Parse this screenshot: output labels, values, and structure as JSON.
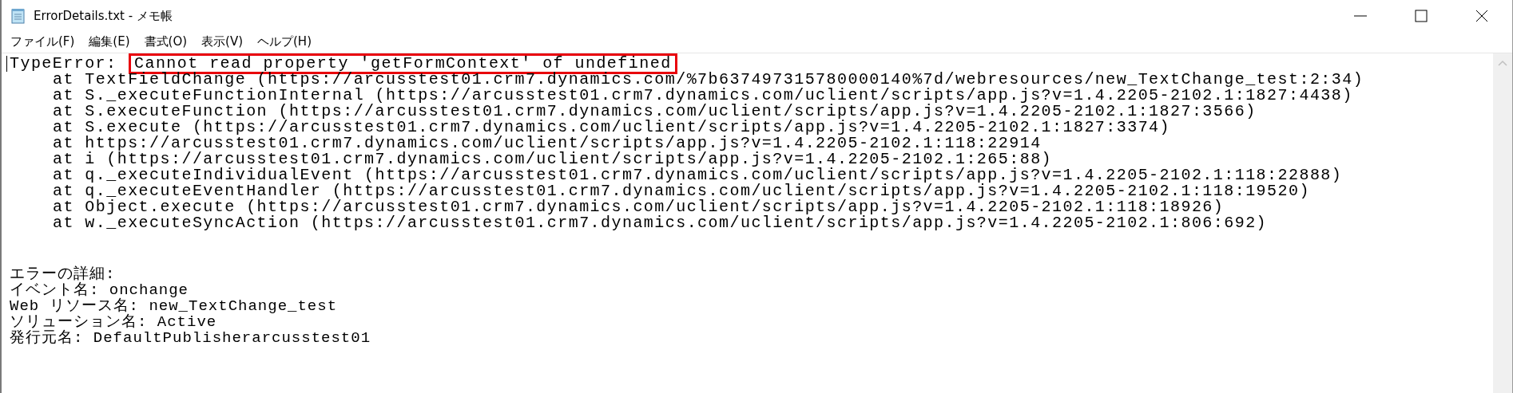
{
  "window": {
    "title": "ErrorDetails.txt - メモ帳"
  },
  "menu": [
    {
      "label": "ファイル(F)"
    },
    {
      "label": "編集(E)"
    },
    {
      "label": "書式(O)"
    },
    {
      "label": "表示(V)"
    },
    {
      "label": "ヘルプ(H)"
    }
  ],
  "stack_trace": [
    {
      "kind": "message",
      "segments": [
        {
          "text": "TypeError: ",
          "highlighted": false
        },
        {
          "text": "Cannot read property 'getFormContext' of undefined",
          "highlighted": true
        }
      ]
    },
    {
      "kind": "frame",
      "segments": [
        {
          "text": "at TextFieldChange (https://arcusstest01.crm7.dynamics.com/%7b637497315780000140%7d/webresources/new_TextChange_test:2:34)",
          "highlighted": false
        }
      ]
    },
    {
      "kind": "frame",
      "segments": [
        {
          "text": "at S._executeFunctionInternal (https://arcusstest01.crm7.dynamics.com/uclient/scripts/app.js?v=1.4.2205-2102.1:1827:4438)",
          "highlighted": false
        }
      ]
    },
    {
      "kind": "frame",
      "segments": [
        {
          "text": "at S.executeFunction (https://arcusstest01.crm7.dynamics.com/uclient/scripts/app.js?v=1.4.2205-2102.1:1827:3566)",
          "highlighted": false
        }
      ]
    },
    {
      "kind": "frame",
      "segments": [
        {
          "text": "at S.execute (https://arcusstest01.crm7.dynamics.com/uclient/scripts/app.js?v=1.4.2205-2102.1:1827:3374)",
          "highlighted": false
        }
      ]
    },
    {
      "kind": "frame",
      "segments": [
        {
          "text": "at https://arcusstest01.crm7.dynamics.com/uclient/scripts/app.js?v=1.4.2205-2102.1:118:22914",
          "highlighted": false
        }
      ]
    },
    {
      "kind": "frame",
      "segments": [
        {
          "text": "at i (https://arcusstest01.crm7.dynamics.com/uclient/scripts/app.js?v=1.4.2205-2102.1:265:88)",
          "highlighted": false
        }
      ]
    },
    {
      "kind": "frame",
      "segments": [
        {
          "text": "at q._executeIndividualEvent (https://arcusstest01.crm7.dynamics.com/uclient/scripts/app.js?v=1.4.2205-2102.1:118:22888)",
          "highlighted": false
        }
      ]
    },
    {
      "kind": "frame",
      "segments": [
        {
          "text": "at q._executeEventHandler (https://arcusstest01.crm7.dynamics.com/uclient/scripts/app.js?v=1.4.2205-2102.1:118:19520)",
          "highlighted": false
        }
      ]
    },
    {
      "kind": "frame",
      "segments": [
        {
          "text": "at Object.execute (https://arcusstest01.crm7.dynamics.com/uclient/scripts/app.js?v=1.4.2205-2102.1:118:18926)",
          "highlighted": false
        }
      ]
    },
    {
      "kind": "frame",
      "segments": [
        {
          "text": "at w._executeSyncAction (https://arcusstest01.crm7.dynamics.com/uclient/scripts/app.js?v=1.4.2205-2102.1:806:692)",
          "highlighted": false
        }
      ]
    }
  ],
  "details": [
    "エラーの詳細:",
    "イベント名: onchange",
    "Web リソース名: new_TextChange_test",
    "ソリューション名: Active",
    "発行元名: DefaultPublisherarcusstest01"
  ]
}
